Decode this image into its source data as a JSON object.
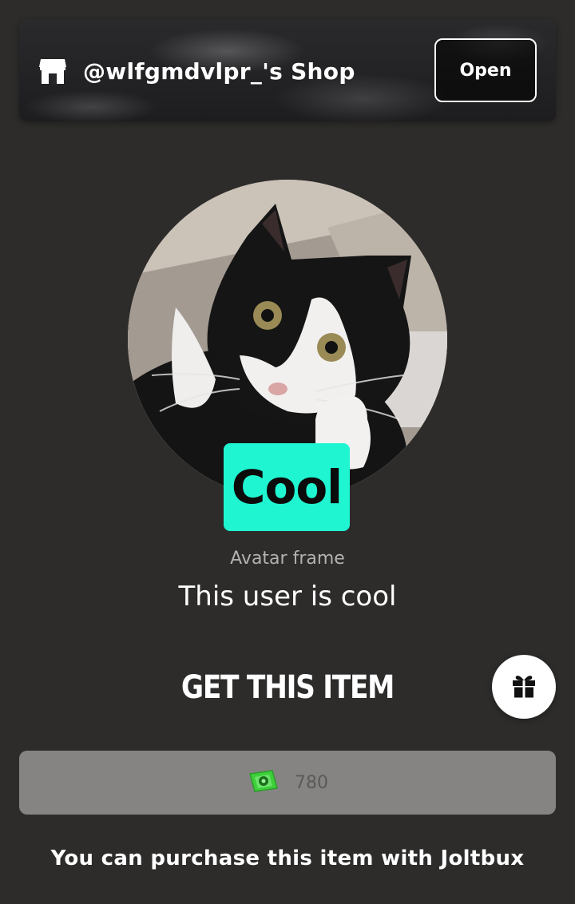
{
  "shop": {
    "title": "@wlfgmdvlpr_'s Shop",
    "open_label": "Open",
    "icon": "store-icon"
  },
  "item": {
    "avatar_icon": "cat-avatar-image",
    "frame_badge_text": "Cool",
    "type": "Avatar frame",
    "name": "This user is cool"
  },
  "purchase": {
    "heading": "GET THIS ITEM",
    "gift_icon": "gift-icon",
    "currency_icon": "joltbux-coin-icon",
    "price": "780",
    "note": "You can purchase this item with Joltbux"
  },
  "colors": {
    "background": "#2d2c2b",
    "badge": "#1ff5d1",
    "buy_button": "#858483",
    "currency_green": "#3ecf3a"
  }
}
